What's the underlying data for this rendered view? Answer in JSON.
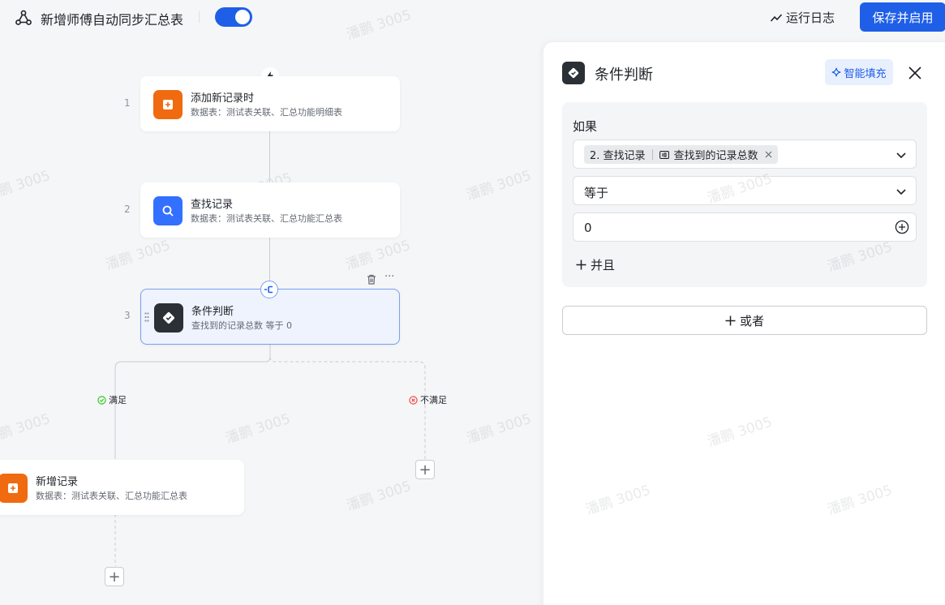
{
  "header": {
    "title": "新增师傅自动同步汇总表",
    "toggle_on": true,
    "run_log_label": "运行日志",
    "save_label": "保存并启用"
  },
  "colors": {
    "primary": "#1f5fe8",
    "orange": "#f06a0f",
    "blue_node": "#3370ff",
    "dark_node": "#2b2f36",
    "success": "#34c724",
    "danger": "#f54a45"
  },
  "workflow": {
    "nodes": [
      {
        "step": "1",
        "title": "添加新记录时",
        "subtitle": "数据表：测试表关联、汇总功能明细表",
        "icon": "add-record-icon"
      },
      {
        "step": "2",
        "title": "查找记录",
        "subtitle": "数据表：测试表关联、汇总功能汇总表",
        "icon": "search-icon"
      },
      {
        "step": "3",
        "title": "条件判断",
        "subtitle": "查找到的记录总数 等于 0",
        "icon": "condition-icon"
      }
    ],
    "branch_yes_label": "满足",
    "branch_no_label": "不满足",
    "branch_node": {
      "title": "新增记录",
      "subtitle": "数据表：测试表关联、汇总功能汇总表",
      "icon": "add-record-icon"
    }
  },
  "watermark_text": "潘鹏 3005",
  "panel": {
    "title": "条件判断",
    "ai_fill_label": "智能填充",
    "if_label": "如果",
    "condition": {
      "source_step": "2. 查找记录",
      "source_field": "查找到的记录总数",
      "operator": "等于",
      "value": "0"
    },
    "and_label": "并且",
    "or_label": "或者"
  }
}
